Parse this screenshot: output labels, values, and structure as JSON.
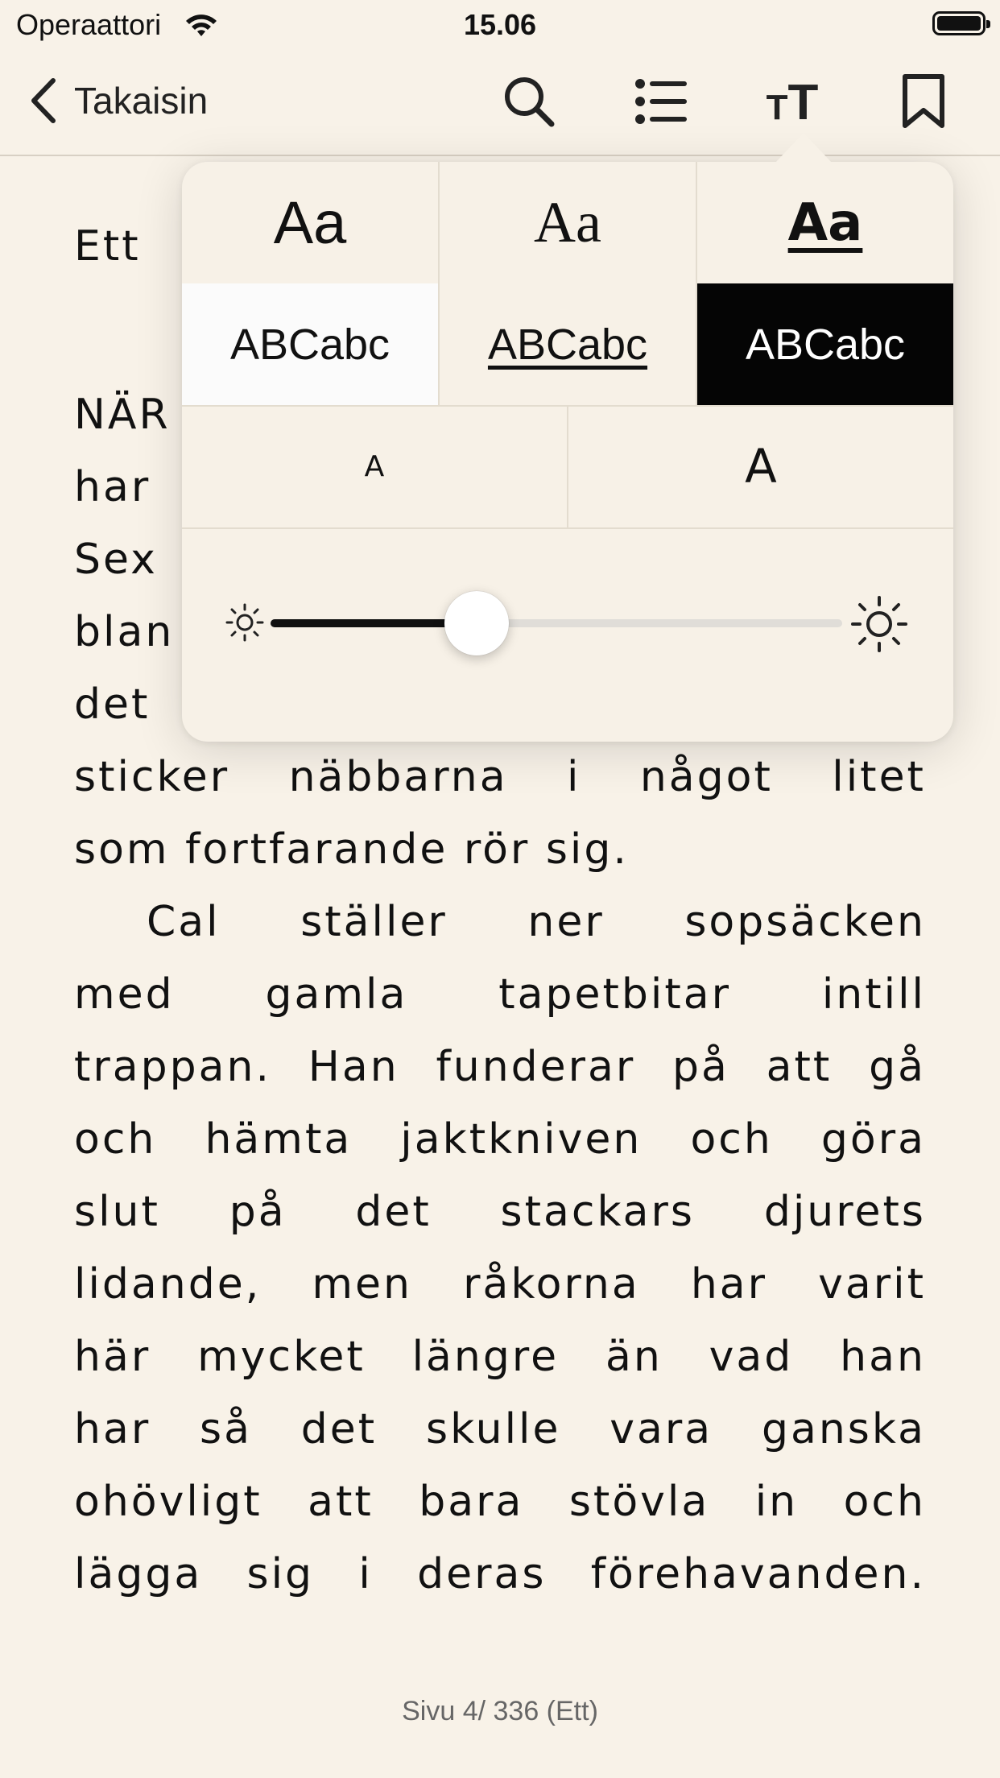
{
  "status_bar": {
    "carrier": "Operaattori",
    "time": "15.06",
    "wifi_icon": "wifi-icon",
    "battery_icon": "battery-icon"
  },
  "nav_bar": {
    "back_label": "Takaisin",
    "icons": [
      "chevron-left-icon",
      "search-icon",
      "list-icon",
      "text-size-icon",
      "bookmark-icon"
    ],
    "text_size_glyph_small": "T",
    "text_size_glyph_large": "T"
  },
  "reader": {
    "chapter_title": "Ett",
    "lines": [
      "NÄR",
      "har",
      "Sex",
      "blan",
      "det",
      "sticker näbbarna i något litet",
      "som fortfarande rör sig.",
      "Cal ställer ner sopsäcken",
      "med gamla tapetbitar intill",
      "trappan. Han funderar på att gå",
      "och hämta jaktkniven och göra",
      "slut på det stackars djurets",
      "lidande, men råkorna har varit",
      "här mycket längre än vad han",
      "har så det skulle vara ganska",
      "ohövligt att bara stövla in och",
      "lägga sig i deras förehavanden."
    ],
    "footer": "Sivu 4/ 336 (Ett)"
  },
  "appearance_popover": {
    "fonts": [
      {
        "label": "Aa",
        "style": "sans"
      },
      {
        "label": "Aa",
        "style": "serif"
      },
      {
        "label": "Aa",
        "style": "rounded-bold",
        "selected": true
      }
    ],
    "themes": [
      {
        "label": "ABCabc",
        "name": "white",
        "background": "#fbfbfb",
        "text": "#111111"
      },
      {
        "label": "ABCabc",
        "name": "sepia",
        "background": "#f7f1e7",
        "text": "#111111",
        "selected": true
      },
      {
        "label": "ABCabc",
        "name": "black",
        "background": "#050505",
        "text": "#ffffff"
      }
    ],
    "size_buttons": [
      {
        "label": "A",
        "action": "decrease"
      },
      {
        "label": "A",
        "action": "increase"
      }
    ],
    "brightness": {
      "value": 0.36,
      "min_icon": "sun-small-icon",
      "max_icon": "sun-large-icon"
    }
  },
  "colors": {
    "page_background": "#f8f2e8",
    "text": "#111111",
    "footer_text": "#666666",
    "divider": "#d8d0c4"
  }
}
